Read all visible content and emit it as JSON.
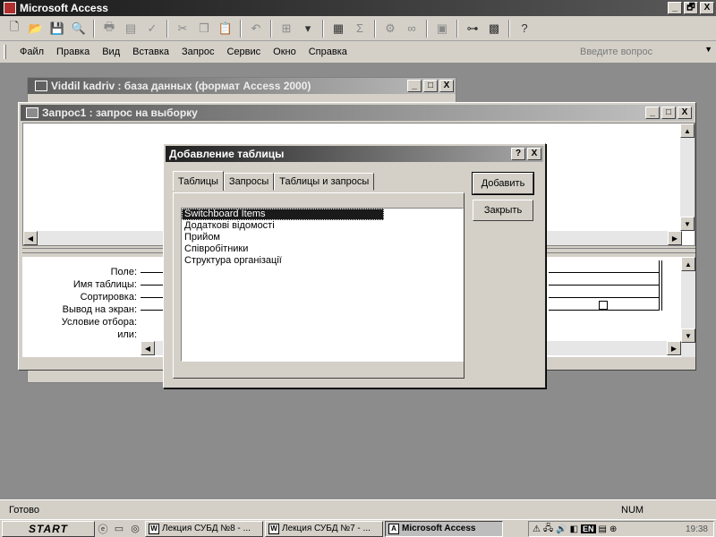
{
  "app": {
    "title": "Microsoft Access"
  },
  "window_buttons": {
    "minimize": "_",
    "restore": "🗗",
    "close": "X"
  },
  "menu": {
    "items": [
      "Файл",
      "Правка",
      "Вид",
      "Вставка",
      "Запрос",
      "Сервис",
      "Окно",
      "Справка"
    ],
    "help_placeholder": "Введите вопрос"
  },
  "db_window": {
    "title": "Viddil kadriv : база данных (формат Access 2000)"
  },
  "query_window": {
    "title": "Запрос1 : запрос на выборку",
    "grid_rows": [
      "Поле:",
      "Имя таблицы:",
      "Сортировка:",
      "Вывод на экран:",
      "Условие отбора:",
      "или:"
    ]
  },
  "dialog": {
    "title": "Добавление таблицы",
    "help_button": "?",
    "close_button": "X",
    "tabs": [
      "Таблицы",
      "Запросы",
      "Таблицы и запросы"
    ],
    "active_tab": "Таблицы",
    "items": [
      "Switchboard Items",
      "Додаткові відомості",
      "Прийом",
      "Співробітники",
      "Структура організації"
    ],
    "selected_item": "Switchboard Items",
    "add_button": "Добавить",
    "close_label": "Закрыть"
  },
  "status": {
    "text": "Готово",
    "num": "NUM"
  },
  "taskbar": {
    "start": "START",
    "tasks": [
      {
        "label": "Лекция СУБД №8 - ...",
        "icon": "W",
        "active": false
      },
      {
        "label": "Лекция СУБД №7 - ...",
        "icon": "W",
        "active": false
      },
      {
        "label": "Microsoft Access",
        "icon": "A",
        "active": true
      }
    ],
    "lang": "EN",
    "clock": "19:38"
  }
}
